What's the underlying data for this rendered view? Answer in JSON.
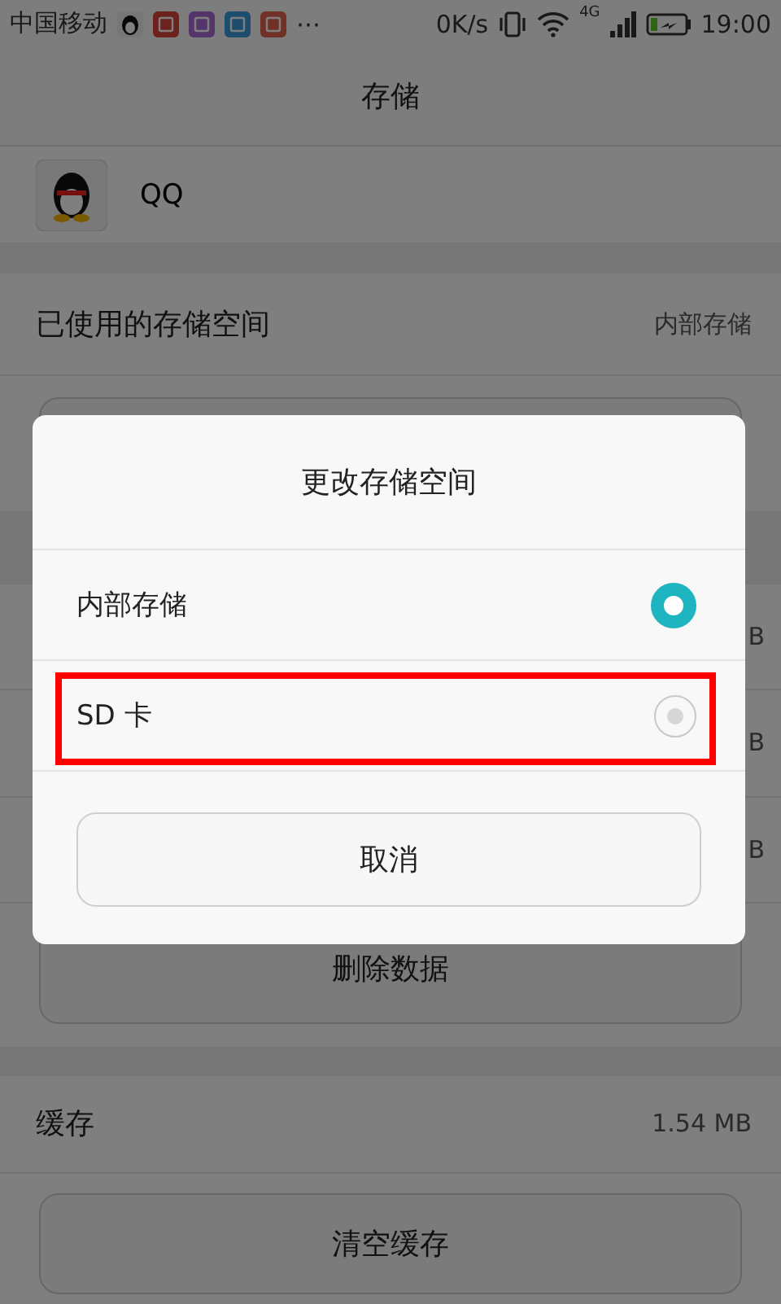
{
  "status_bar": {
    "carrier": "中国移动",
    "more": "⋯",
    "speed": "0K/s",
    "network": "4G",
    "time": "19:00"
  },
  "header": {
    "title": "存储"
  },
  "app": {
    "name": "QQ"
  },
  "storage_used": {
    "label": "已使用的存储空间",
    "value": "内部存储"
  },
  "hidden_rows": [
    {
      "value": "B"
    },
    {
      "value": "B"
    },
    {
      "value": "B"
    }
  ],
  "buttons": [
    {
      "label": "删除数据"
    }
  ],
  "cache": {
    "label": "缓存",
    "value": "1.54 MB",
    "button": "清空缓存"
  },
  "dialog": {
    "title": "更改存储空间",
    "options": [
      {
        "label": "内部存储",
        "selected": true
      },
      {
        "label": "SD 卡",
        "selected": false
      }
    ],
    "cancel": "取消"
  }
}
